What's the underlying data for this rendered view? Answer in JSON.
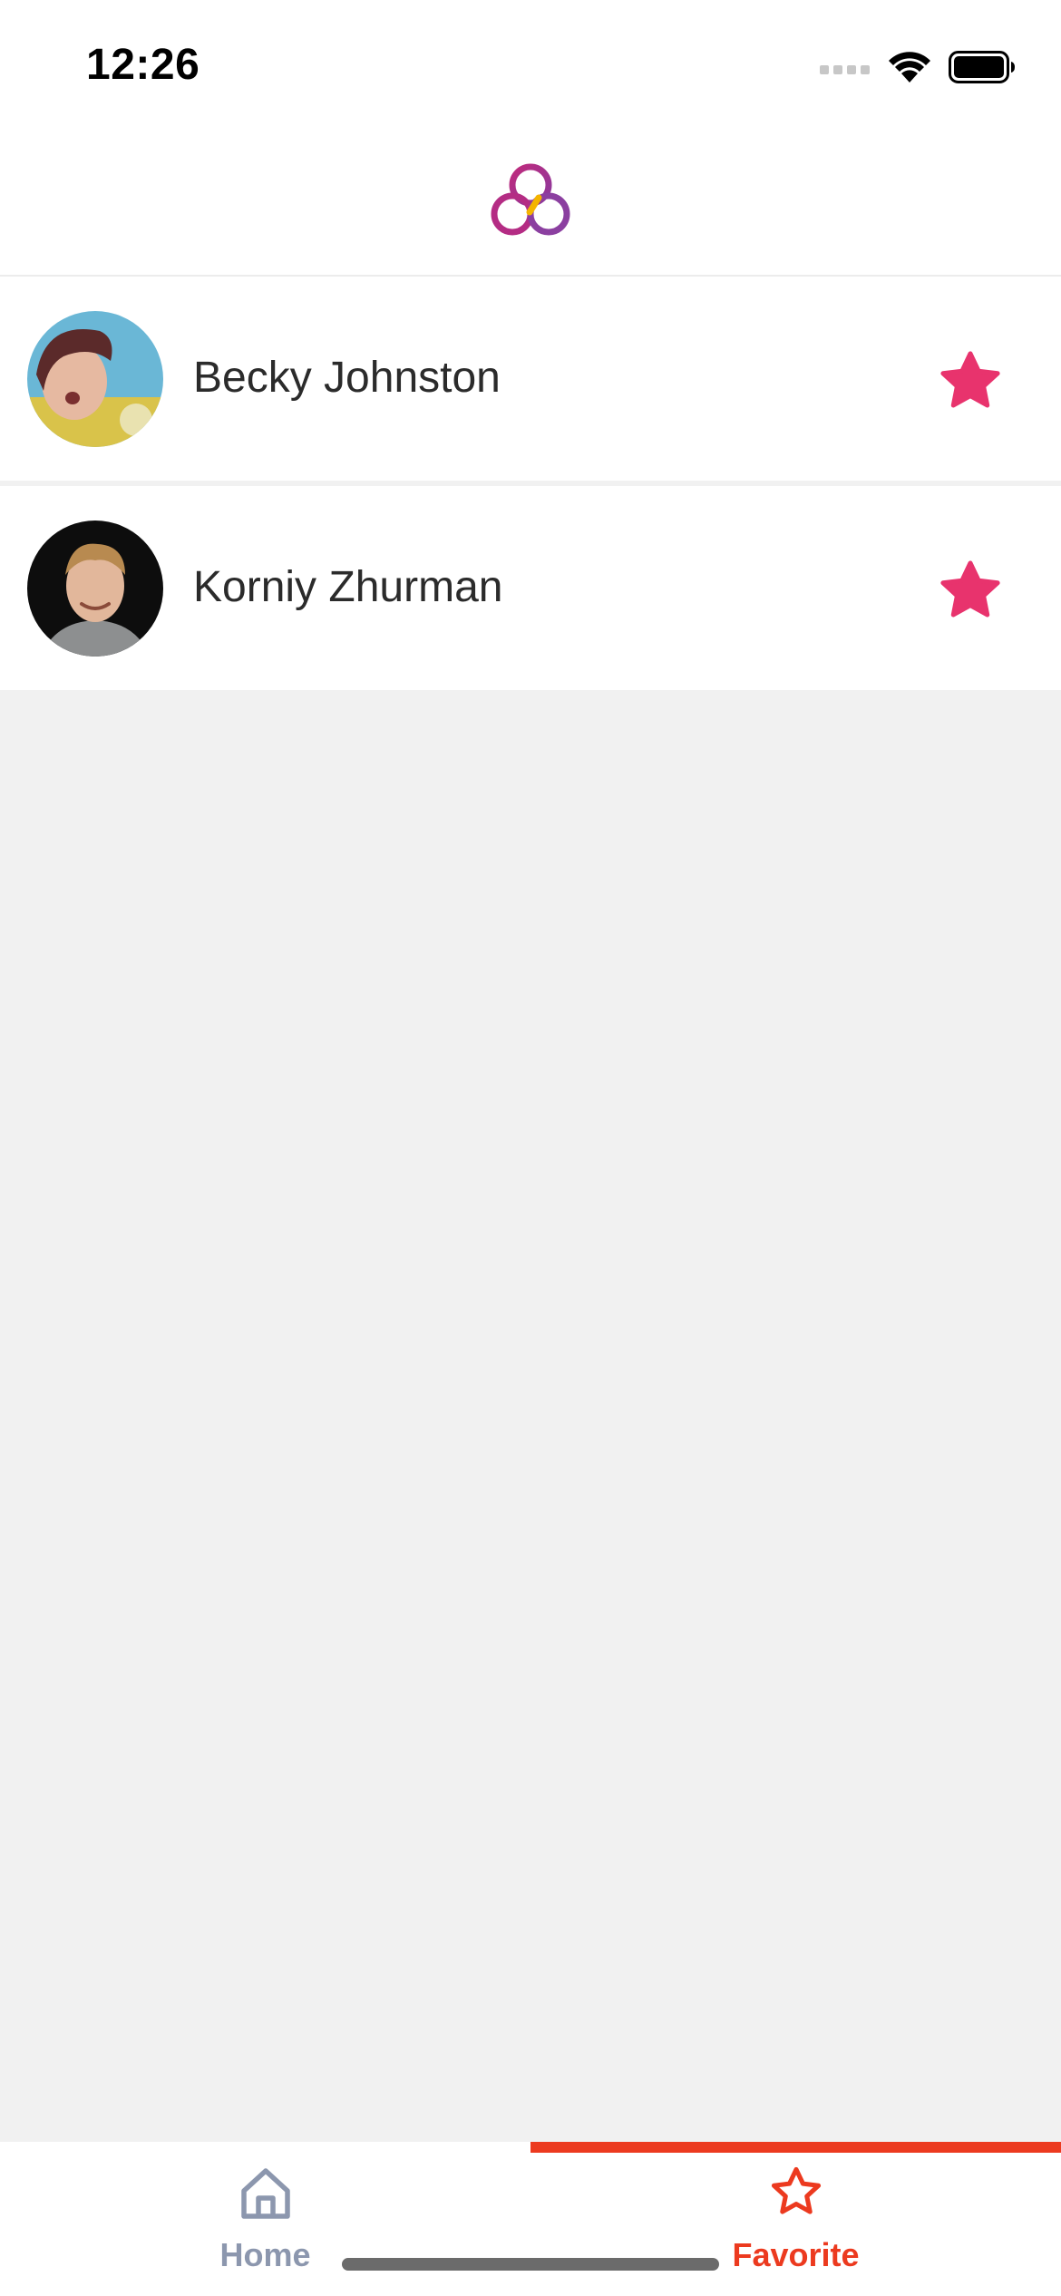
{
  "status_bar": {
    "time": "12:26",
    "icons": [
      "cellular-signal-icon",
      "wifi-icon",
      "battery-icon"
    ]
  },
  "header": {
    "logo": "app-logo"
  },
  "favorites": [
    {
      "name": "Becky Johnston",
      "favorite": true
    },
    {
      "name": "Korniy Zhurman",
      "favorite": true
    }
  ],
  "tabs": [
    {
      "label": "Home",
      "icon": "home-icon",
      "active": false
    },
    {
      "label": "Favorite",
      "icon": "star-outline-icon",
      "active": true
    }
  ],
  "colors": {
    "accent": "#ec3a1f",
    "star": "#e8336d",
    "inactive_tab": "#8c97ae",
    "background": "#f1f1f1"
  }
}
